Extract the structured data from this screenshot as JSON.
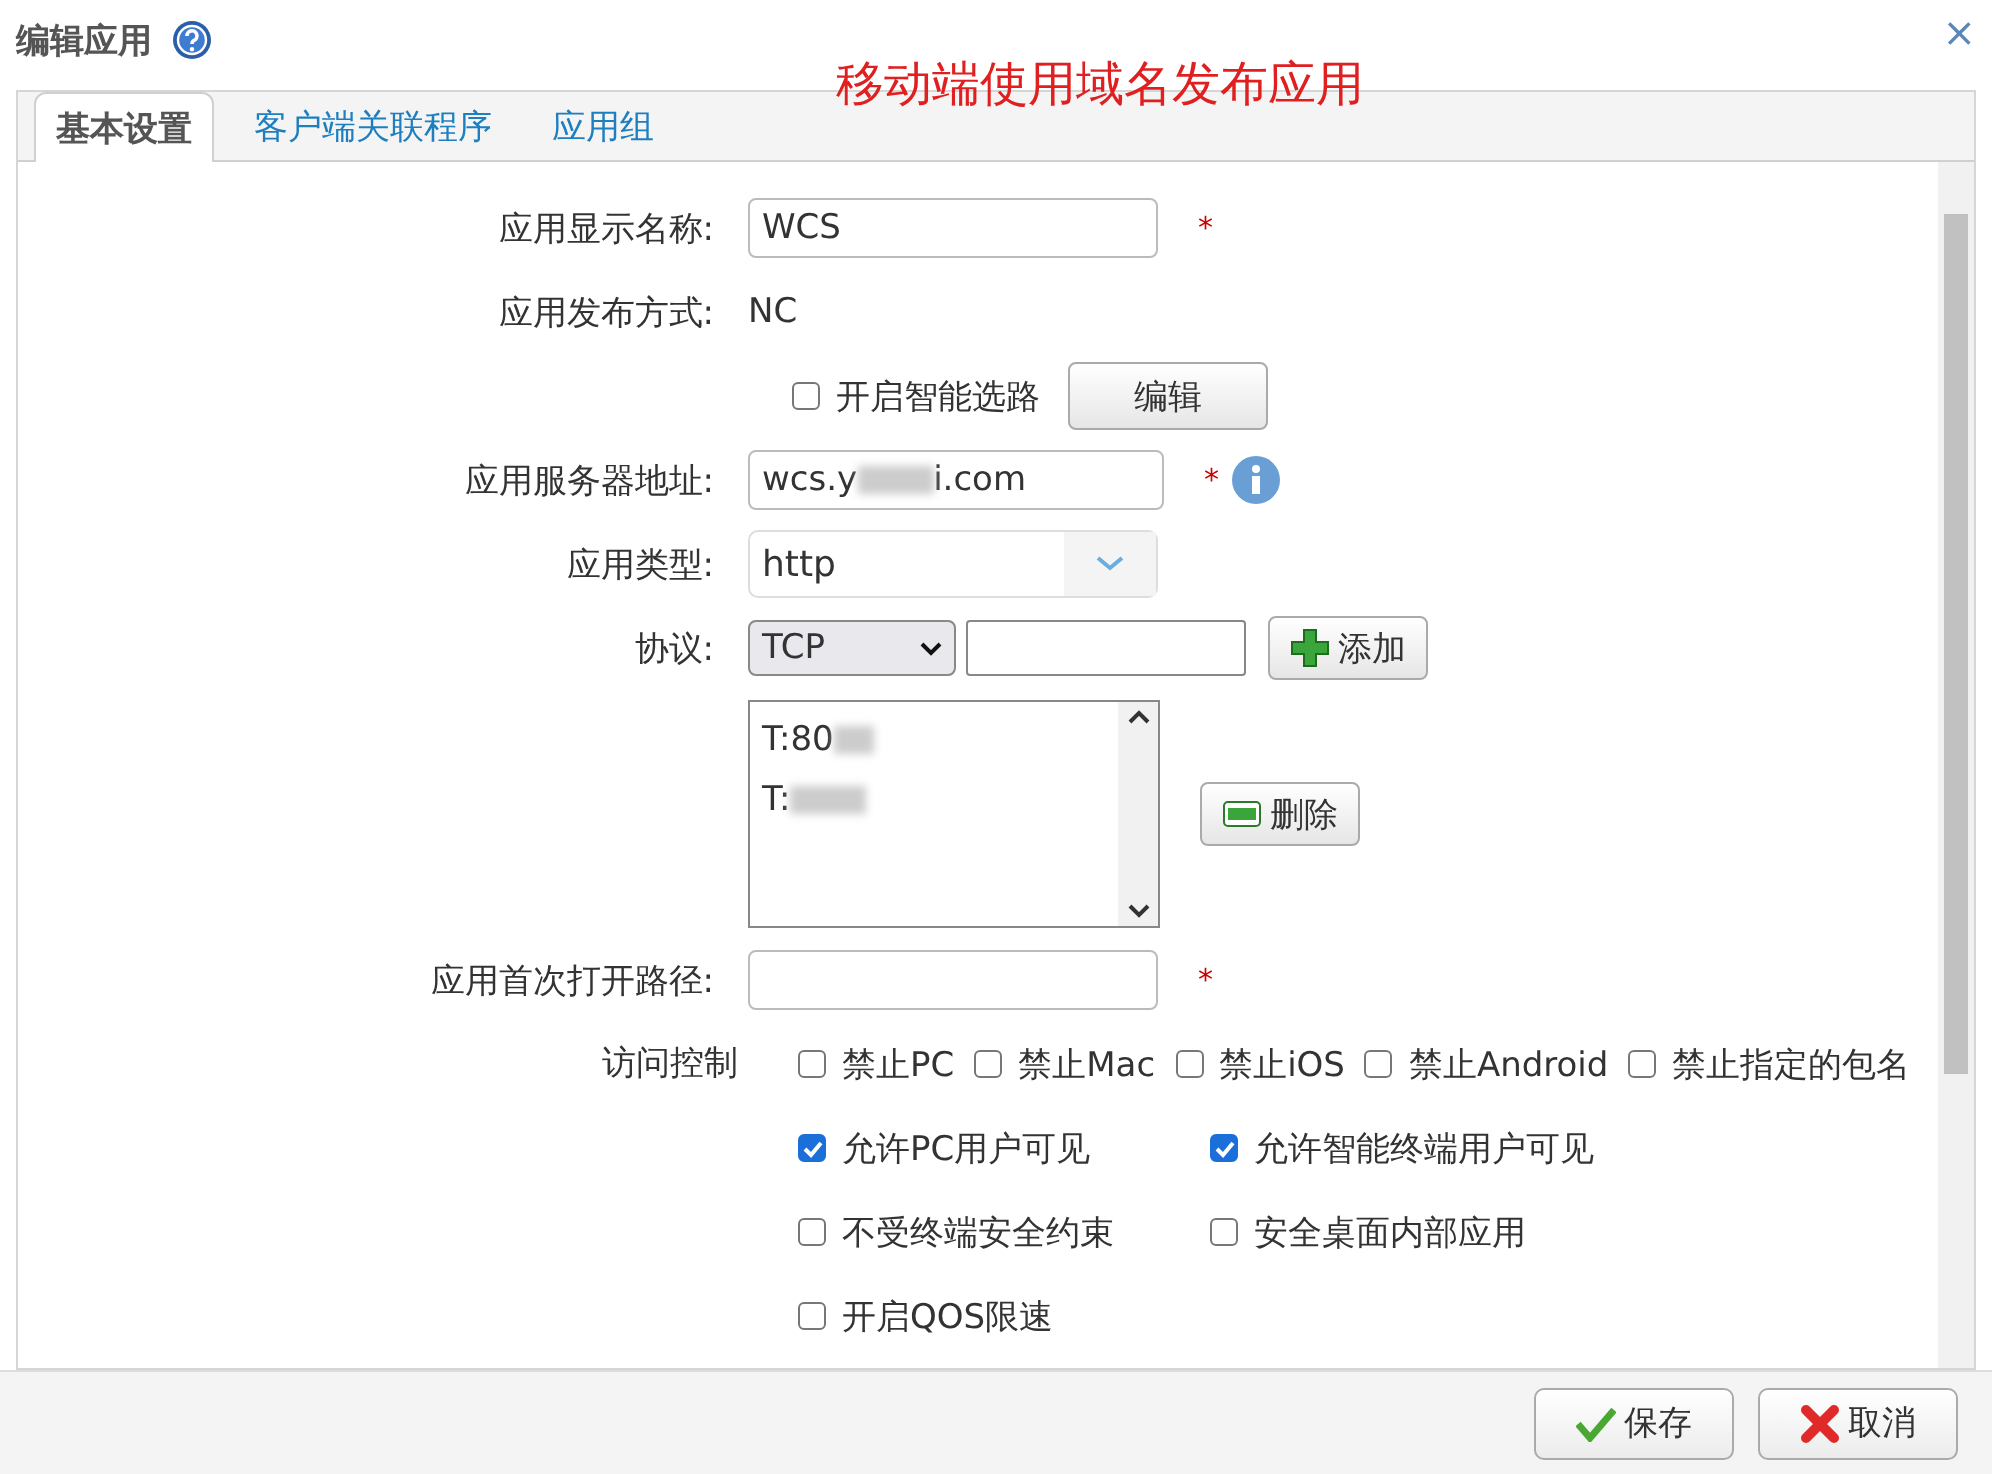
{
  "window": {
    "title": "编辑应用",
    "annotation": "移动端使用域名发布应用",
    "close": "×"
  },
  "tabs": [
    {
      "label": "基本设置",
      "selected": true
    },
    {
      "label": "客户端关联程序",
      "selected": false
    },
    {
      "label": "应用组",
      "selected": false
    }
  ],
  "form": {
    "display_name": {
      "label": "应用显示名称:",
      "value": "WCS",
      "required_mark": "*"
    },
    "publish_mode": {
      "label": "应用发布方式:",
      "value": "NC"
    },
    "smart_route": {
      "label": "开启智能选路",
      "checked": false,
      "button": "编辑"
    },
    "server_address": {
      "label": "应用服务器地址:",
      "value_start": "wcs.y",
      "value_end": "i.com",
      "required_mark": "*"
    },
    "app_type": {
      "label": "应用类型:",
      "value": "http"
    },
    "protocol": {
      "label": "协议:",
      "value": "TCP",
      "add_button": "添加"
    },
    "ports": {
      "items": [
        {
          "text": "T:80"
        },
        {
          "text": "T:"
        }
      ],
      "delete_button": "删除"
    },
    "first_path": {
      "label": "应用首次打开路径:",
      "required_mark": "*"
    },
    "access": {
      "label": "访问控制",
      "rows": [
        [
          {
            "label": "禁止PC",
            "checked": false
          },
          {
            "label": "禁止Mac",
            "checked": false
          },
          {
            "label": "禁止iOS",
            "checked": false
          },
          {
            "label": "禁止Android",
            "checked": false
          },
          {
            "label": "禁止指定的包名",
            "checked": false
          }
        ],
        [
          {
            "label": "允许PC用户可见",
            "checked": true
          },
          {
            "label": "允许智能终端用户可见",
            "checked": true
          }
        ],
        [
          {
            "label": "不受终端安全约束",
            "checked": false
          },
          {
            "label": "安全桌面内部应用",
            "checked": false
          }
        ],
        [
          {
            "label": "开启QOS限速",
            "checked": false
          }
        ]
      ]
    }
  },
  "buttons": [
    {
      "label": "保存",
      "kind": "save"
    },
    {
      "label": "取消",
      "kind": "cancel"
    }
  ]
}
